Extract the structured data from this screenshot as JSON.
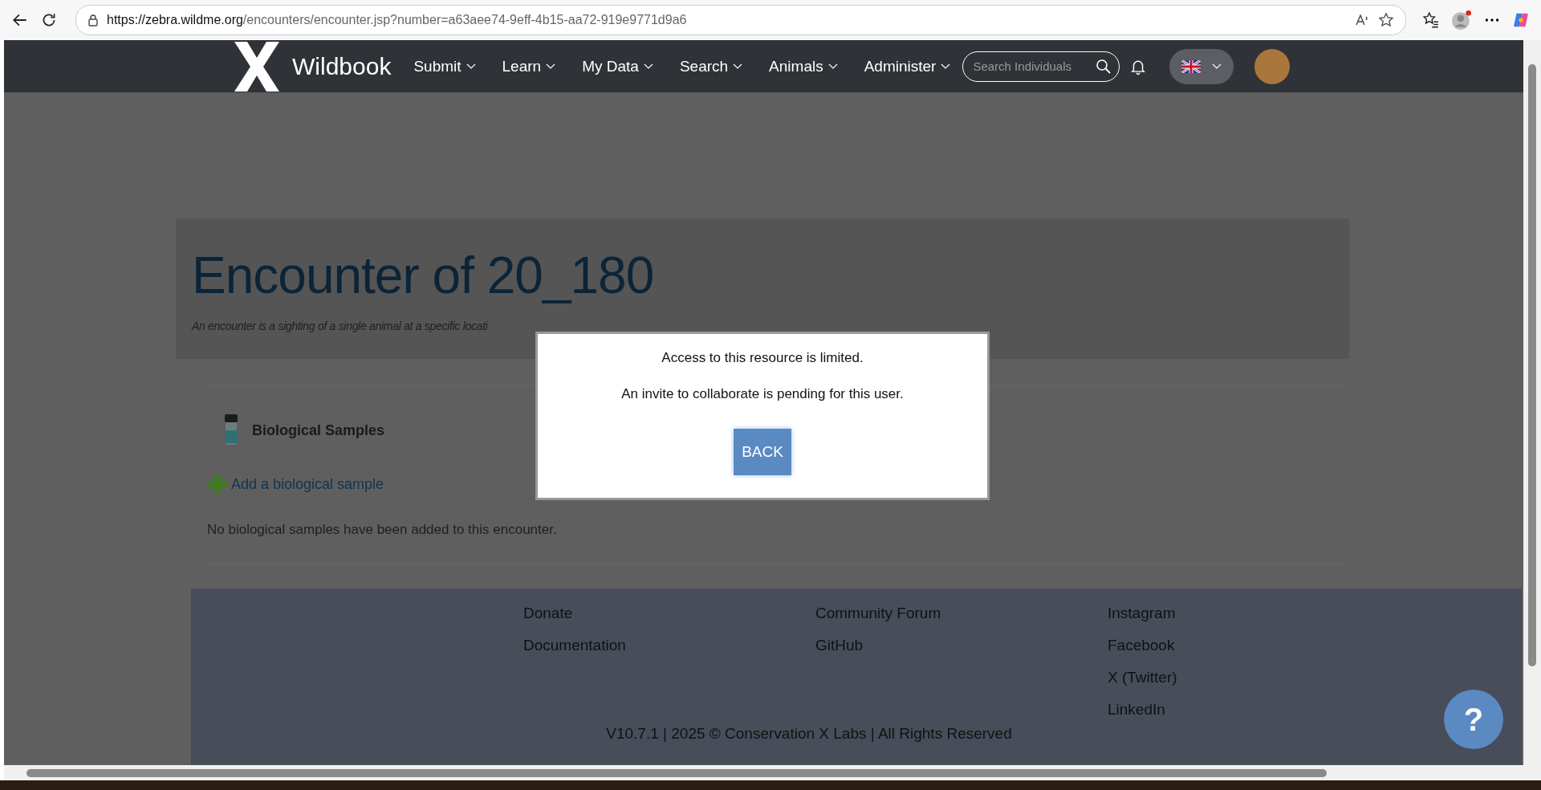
{
  "browser": {
    "url_host": "https://zebra.wildme.org",
    "url_path": "/encounters/encounter.jsp?number=a63aee74-9eff-4b15-aa72-919e9771d9a6"
  },
  "nav": {
    "brand": "Wildbook",
    "items": [
      "Submit",
      "Learn",
      "My Data",
      "Search",
      "Animals",
      "Administer"
    ],
    "search": {
      "placeholder": "Search Individuals"
    }
  },
  "header": {
    "title": "Encounter of 20_180",
    "subtitle": "An encounter is a sighting of a single animal at a specific locati"
  },
  "samples": {
    "heading": "Biological Samples",
    "add_link": "Add a biological sample",
    "empty_message": "No biological samples have been added to this encounter."
  },
  "footer": {
    "columns": [
      [
        "Donate",
        "Documentation"
      ],
      [
        "Community Forum",
        "GitHub"
      ],
      [
        "Instagram",
        "Facebook",
        "X (Twitter)",
        "LinkedIn"
      ]
    ],
    "copyright": "V10.7.1 | 2025 © Conservation X Labs | All Rights Reserved"
  },
  "modal": {
    "lines": [
      "Access to this resource is limited.",
      "An invite to collaborate is pending for this user."
    ],
    "button": "BACK"
  },
  "help_button": "?"
}
